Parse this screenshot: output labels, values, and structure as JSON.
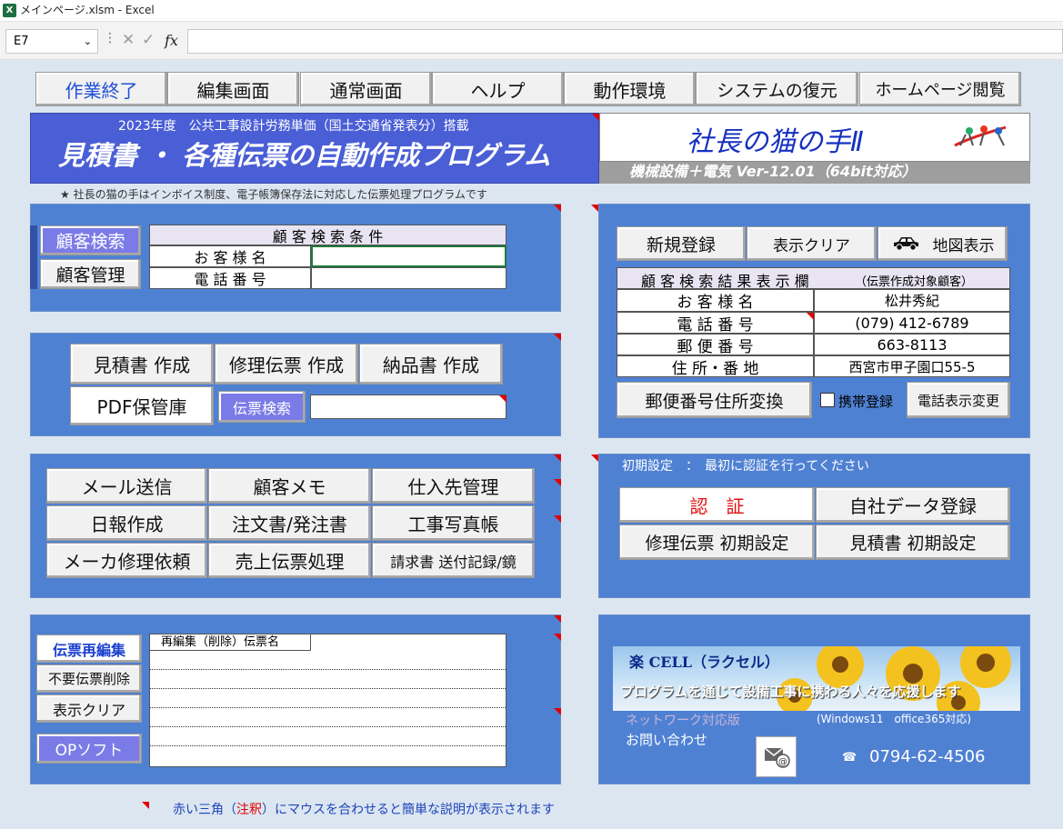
{
  "window": {
    "title": "メインページ.xlsm - Excel",
    "app_icon": "excel-icon"
  },
  "formula_bar": {
    "name_box": "E7",
    "cancel": "✕",
    "enter": "✓",
    "fx": "fx",
    "value": ""
  },
  "top_menu": [
    "作業終了",
    "編集画面",
    "通常画面",
    "ヘルプ",
    "動作環境",
    "システムの復元",
    "ホームページ閲覧"
  ],
  "header": {
    "subtitle": "2023年度　公共工事設計労務単価（国土交通省発表分）搭載",
    "title": "見積書 ・ 各種伝票の自動作成プログラム",
    "product": "社長の猫の手Ⅱ",
    "version": "機械設備＋電気  Ver-12.01（64bit対応）",
    "note": "★ 社長の猫の手はインボイス制度、電子帳簿保存法に対応した伝票処理プログラムです"
  },
  "search_panel": {
    "search_button": "顧客検索",
    "manage_button": "顧客管理",
    "condition_header": "顧 客 検 索 条 件",
    "name_label": "お 客 様 名",
    "phone_label": "電 話 番 号",
    "name_value": "",
    "phone_value": ""
  },
  "slip_panel": {
    "estimate": "見積書 作成",
    "repair": "修理伝票 作成",
    "delivery": "納品書 作成",
    "pdf": "PDF保管庫",
    "slip_search": "伝票検索",
    "slip_search_value": ""
  },
  "tools_panel": {
    "buttons": [
      "メール送信",
      "顧客メモ",
      "仕入先管理",
      "日報作成",
      "注文書/発注書",
      "工事写真帳",
      "メーカ修理依頼",
      "売上伝票処理",
      "請求書 送付記録/鏡"
    ]
  },
  "reedit_panel": {
    "reedit": "伝票再編集",
    "delete": "不要伝票削除",
    "clear": "表示クリア",
    "op": "OPソフト",
    "list_header": "再編集（削除）伝票名",
    "rows": [
      "",
      "",
      "",
      "",
      ""
    ]
  },
  "result_panel": {
    "new": "新規登録",
    "clear": "表示クリア",
    "map": "地図表示",
    "car_icon": "car-icon",
    "header": "顧 客 検 索 結 果 表 示 欄",
    "header_note": "（伝票作成対象顧客）",
    "rows": [
      {
        "label": "お 客 様 名",
        "value": "松井秀紀"
      },
      {
        "label": "電 話 番 号",
        "value": "(079) 412-6789"
      },
      {
        "label": "郵 便 番 号",
        "value": "663-8113"
      },
      {
        "label": "住 所・番 地",
        "value": "西宮市甲子園口55-5"
      }
    ],
    "zip_convert": "郵便番号住所変換",
    "mobile_label": "携帯登録",
    "mobile_checked": false,
    "phone_change": "電話表示変更"
  },
  "setup_panel": {
    "heading": "初期設定　：　最初に認証を行ってください",
    "auth": "認　証",
    "company": "自社データ登録",
    "repair_setup": "修理伝票 初期設定",
    "estimate_setup": "見積書 初期設定"
  },
  "company_panel": {
    "banner_title": "楽 CELL（ラクセル）",
    "banner_text": "プログラムを通じて設備工事に携わる人々を応援します",
    "network": "ネットワーク対応版",
    "compat": "(Windows11　office365対応)",
    "contact": "お問い合わせ",
    "mail_icon": "mail-icon",
    "phone_icon": "phone-icon",
    "phone": "0794-62-4506"
  },
  "footer": {
    "pre": "赤い三角（",
    "red": "注釈",
    "post": "）にマウスを合わせると簡単な説明が表示されます"
  },
  "colors": {
    "panel": "#4f81d3",
    "title_bg": "#4a5ed6",
    "accent_red": "#e00000",
    "button": "#f1f1f1",
    "purple_button": "#7b7be8"
  }
}
